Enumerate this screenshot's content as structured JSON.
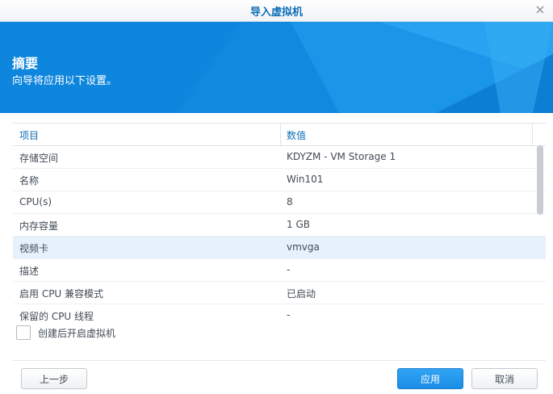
{
  "window": {
    "title": "导入虚拟机"
  },
  "banner": {
    "heading": "摘要",
    "subheading": "向导将应用以下设置。"
  },
  "grid": {
    "columns": [
      "项目",
      "数值"
    ],
    "rows": [
      {
        "item": "存储空间",
        "value": "KDYZM - VM Storage 1"
      },
      {
        "item": "名称",
        "value": "Win101"
      },
      {
        "item": "CPU(s)",
        "value": "8"
      },
      {
        "item": "内存容量",
        "value": "1 GB"
      },
      {
        "item": "视频卡",
        "value": "vmvga"
      },
      {
        "item": "描述",
        "value": "-"
      },
      {
        "item": "启用 CPU 兼容模式",
        "value": "已启动"
      },
      {
        "item": "保留的 CPU 线程",
        "value": "-"
      }
    ],
    "selected_row": 4
  },
  "options": {
    "power_on_label": "创建后开启虚拟机",
    "power_on_checked": false
  },
  "footer": {
    "prev_label": "上一步",
    "apply_label": "应用",
    "cancel_label": "取消"
  },
  "colors": {
    "accent": "#1189df",
    "header_text": "#0e6fb7",
    "selected_row": "#e6f1fb"
  },
  "icons": {
    "close": "close-icon"
  }
}
